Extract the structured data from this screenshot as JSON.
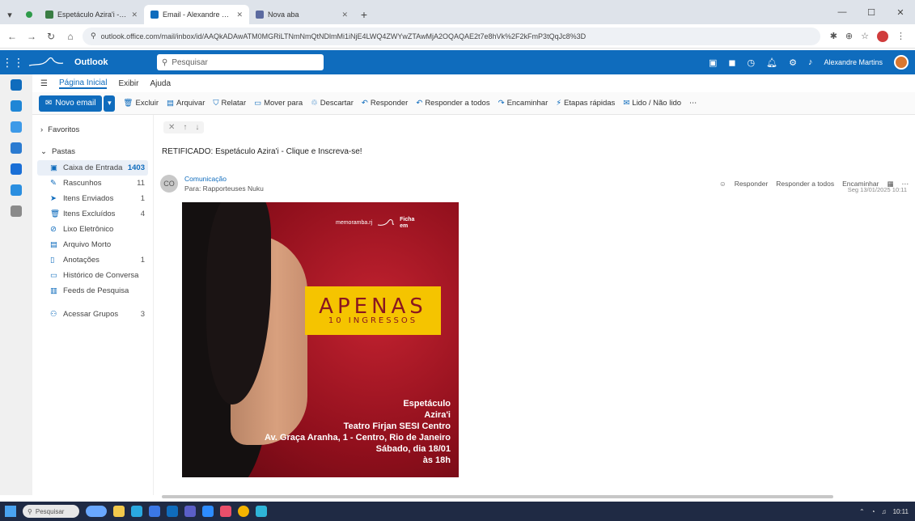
{
  "browser": {
    "tabs": [
      {
        "label": "Espetáculo Azira'i - Cliqu…",
        "favicon_color": "#3a7d44",
        "active": false
      },
      {
        "label": "Email - Alexandre Martins - Ou…",
        "favicon_color": "#0f6cbd",
        "active": true
      },
      {
        "label": "Nova aba",
        "favicon_color": "#5b6aa0",
        "active": false
      }
    ],
    "new_tab_glyph": "+",
    "url": "outlook.office.com/mail/inbox/id/AAQkADAwATM0MGRiLTNmNmQtNDlmMi1iNjE4LWQ4ZWYwZTAwMjA2OQAQAE2t7e8hVk%2F2kFmP3tQqJc8%3D"
  },
  "outlook": {
    "app_name": "Outlook",
    "search_placeholder": "Pesquisar",
    "user_name": "Alexandre Martins"
  },
  "ribbon": {
    "tabs": [
      {
        "label": "Página Inicial",
        "active": true
      },
      {
        "label": "Exibir",
        "active": false
      },
      {
        "label": "Ajuda",
        "active": false
      }
    ],
    "new_mail_label": "Novo email",
    "commands": [
      "Excluir",
      "Arquivar",
      "Relatar",
      "Mover para",
      "Descartar",
      "Responder",
      "Responder a todos",
      "Encaminhar",
      "Etapas rápidas",
      "Lido / Não lido"
    ]
  },
  "folders": {
    "favorites_label": "Favoritos",
    "folders_label": "Pastas",
    "items": [
      {
        "label": "Caixa de Entrada",
        "count": "1403",
        "selected": true,
        "icon": "inbox-icon"
      },
      {
        "label": "Rascunhos",
        "count": "11",
        "selected": false,
        "icon": "drafts-icon"
      },
      {
        "label": "Itens Enviados",
        "count": "1",
        "selected": false,
        "icon": "sent-icon"
      },
      {
        "label": "Itens Excluídos",
        "count": "4",
        "selected": false,
        "icon": "trash-icon"
      },
      {
        "label": "Lixo Eletrônico",
        "count": "",
        "selected": false,
        "icon": "junk-icon"
      },
      {
        "label": "Arquivo Morto",
        "count": "",
        "selected": false,
        "icon": "archive-icon"
      },
      {
        "label": "Anotações",
        "count": "1",
        "selected": false,
        "icon": "notes-icon"
      },
      {
        "label": "Histórico de Conversa",
        "count": "",
        "selected": false,
        "icon": "history-icon"
      },
      {
        "label": "Feeds de Pesquisa",
        "count": "",
        "selected": false,
        "icon": "feed-icon"
      },
      {
        "label": "Acessar Grupos",
        "count": "3",
        "selected": false,
        "icon": "groups-icon"
      }
    ]
  },
  "message": {
    "subject": "RETIFICADO: Espetáculo Azira'i - Clique e Inscreva-se!",
    "sender_name": "Comunicação",
    "sender_initials": "CO",
    "to_line": "Para: Rapporteuses Nuku",
    "date": "Seg 13/01/2025 10:11",
    "actions": [
      "Responder",
      "Responder a todos",
      "Encaminhar"
    ],
    "poster": {
      "brand_left": "memoramba.rj",
      "brand_right_1": "Ficha",
      "brand_right_2": "em",
      "badge_big": "APENAS",
      "badge_small": "10 INGRESSOS",
      "lines": [
        "Espetáculo",
        "Azira'i",
        "Teatro Firjan SESI Centro",
        "Av. Graça Aranha, 1 - Centro, Rio de Janeiro",
        "Sábado, dia 18/01",
        "às 18h"
      ]
    }
  },
  "taskbar": {
    "search_placeholder": "Pesquisar",
    "clock": "10:11"
  },
  "colors": {
    "brand_blue": "#0f6cbd",
    "poster_red": "#b01a28",
    "badge_yellow": "#f5c400"
  }
}
